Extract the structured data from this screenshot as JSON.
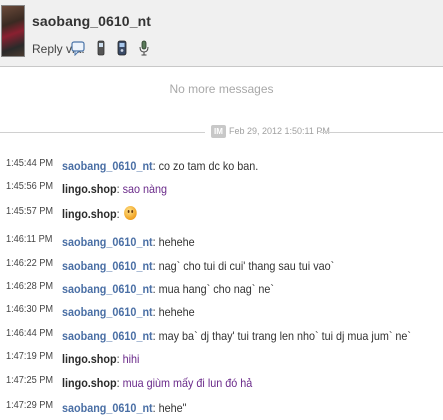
{
  "header": {
    "username": "saobang_0610_nt",
    "reply_via_label": "Reply via:",
    "reply_icons": [
      "chat-bubble-icon",
      "mobile-phone-icon",
      "blackberry-icon",
      "microphone-icon"
    ]
  },
  "status": {
    "no_more": "No more messages"
  },
  "separator": {
    "badge": "IM",
    "date": "Feb 29, 2012 1:50:11 PM"
  },
  "messages": [
    {
      "time": "1:45:44 PM",
      "sender": "saobang_0610_nt",
      "text": "co zo tam dc ko ban."
    },
    {
      "time": "1:45:56 PM",
      "sender": "lingo.shop",
      "text": "sao nàng"
    },
    {
      "time": "1:45:57 PM",
      "sender": "lingo.shop",
      "text": "",
      "emoticon": "smiley-icon"
    },
    {
      "time": "1:46:11 PM",
      "sender": "saobang_0610_nt",
      "text": "hehehe"
    },
    {
      "time": "1:46:22 PM",
      "sender": "saobang_0610_nt",
      "text": "nag` cho tui di cui' thang sau tui vao`"
    },
    {
      "time": "1:46:28 PM",
      "sender": "saobang_0610_nt",
      "text": "mua hang` cho nag` ne`"
    },
    {
      "time": "1:46:30 PM",
      "sender": "saobang_0610_nt",
      "text": "hehehe"
    },
    {
      "time": "1:46:44 PM",
      "sender": "saobang_0610_nt",
      "text": "may ba` dj thay' tui trang len nho` tui dj mua jum` ne`"
    },
    {
      "time": "1:47:19 PM",
      "sender": "lingo.shop",
      "text": "hihi"
    },
    {
      "time": "1:47:25 PM",
      "sender": "lingo.shop",
      "text": "mua giùm mấy đi lun đó hả"
    },
    {
      "time": "1:47:29 PM",
      "sender": "saobang_0610_nt",
      "text": "hehe\""
    }
  ]
}
